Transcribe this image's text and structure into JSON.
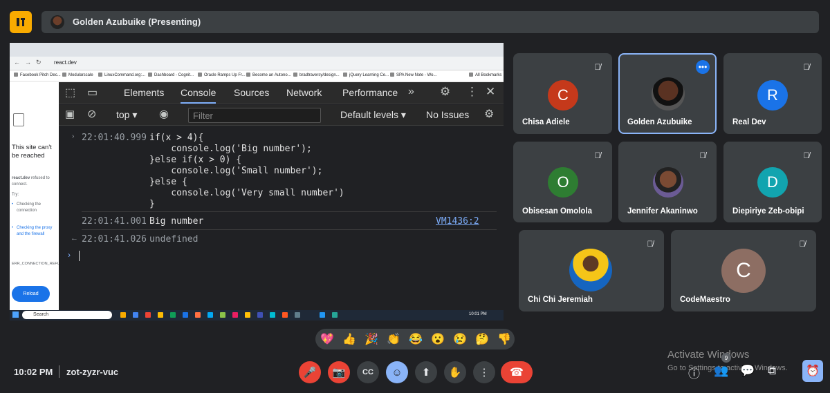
{
  "presenter": {
    "name": "Golden Azubuike (Presenting)"
  },
  "browser": {
    "url": "react.dev",
    "bookmarks": [
      "Facebook Pitch Dec...",
      "Modularscale",
      "LinuxCommand.org:...",
      "Dashboard - Cognit...",
      "Oracle Ramps Up Fr...",
      "Become an Autono...",
      "bradtraversy/design...",
      "jQuery Learning Ce...",
      "SPA New Note - Wo...",
      "All Bookmarks"
    ]
  },
  "error_page": {
    "title": "This site can't be reached",
    "host": "react.dev",
    "host_suffix": " refused to connect.",
    "try": "Try:",
    "items": [
      "Checking the connection",
      "Checking the proxy and the firewall"
    ],
    "code": "ERR_CONNECTION_REFUSED",
    "reload": "Reload"
  },
  "devtools": {
    "tabs": [
      "Elements",
      "Console",
      "Sources",
      "Network",
      "Performance"
    ],
    "context": "top",
    "filter_placeholder": "Filter",
    "levels": "Default levels",
    "issues": "No Issues",
    "entries": {
      "ts1": "22:01:40.999",
      "code": [
        "if(x > 4){",
        "    console.log('Big number');",
        "}else if(x > 0) {",
        "    console.log('Small number');",
        "}else {",
        "    console.log('Very small number')",
        "}"
      ],
      "ts2": "22:01:41.001",
      "log": "Big number",
      "src": "VM1436:2",
      "ts3": "22:01:41.026",
      "ret": "undefined"
    },
    "taskbar_search": "Search",
    "taskbar_time": "10:01 PM"
  },
  "participants": [
    {
      "name": "Chisa Adiele",
      "initial": "C",
      "color": "#c5391b"
    },
    {
      "name": "Golden Azubuike",
      "initial": "",
      "color": "#2a2a2a"
    },
    {
      "name": "Real Dev",
      "initial": "R",
      "color": "#1a73e8"
    },
    {
      "name": "Obisesan Omololа",
      "initial": "O",
      "color": "#2e7d32"
    },
    {
      "name": "Jennifer Akaninwo",
      "initial": "",
      "color": "#6b5b95"
    },
    {
      "name": "Diepiriye Zeb-obipi",
      "initial": "D",
      "color": "#12a4af"
    },
    {
      "name": "Chi Chi Jeremiah",
      "initial": "",
      "color": "#1565c0"
    },
    {
      "name": "CodeMaestro",
      "initial": "C",
      "color": "#8d6e63"
    }
  ],
  "reactions": [
    "💖",
    "👍",
    "🎉",
    "👏",
    "😂",
    "😮",
    "😢",
    "🤔",
    "👎"
  ],
  "footer": {
    "time": "10:02 PM",
    "meeting_code": "zot-zyzr-vuc",
    "people_count": "9",
    "activate_title": "Activate Windows",
    "activate_sub": "Go to Settings to activate Windows."
  }
}
